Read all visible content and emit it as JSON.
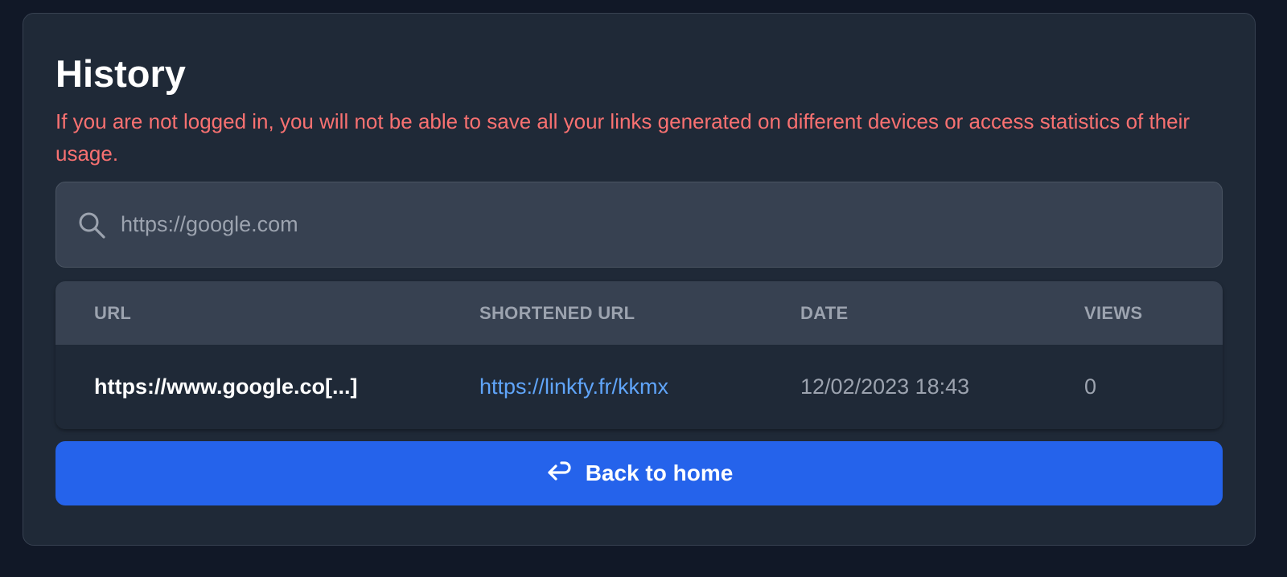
{
  "history": {
    "title": "History",
    "warning": "If you are not logged in, you will not be able to save all your links generated on different devices or access statistics of their usage."
  },
  "search": {
    "placeholder": "https://google.com",
    "value": "",
    "icon": "search-icon"
  },
  "table": {
    "headers": [
      "URL",
      "SHORTENED URL",
      "DATE",
      "VIEWS"
    ],
    "rows": [
      {
        "url": "https://www.google.co[...]",
        "shortened_url": "https://linkfy.fr/kkmx",
        "date": "12/02/2023 18:43",
        "views": "0"
      }
    ]
  },
  "back_button": {
    "label": "Back to home",
    "icon": "return-arrow-icon"
  },
  "colors": {
    "page_background": "#111827",
    "card_background": "#1f2937",
    "warning_text": "#f87171",
    "link": "#60a5fa",
    "primary_button": "#2563eb"
  }
}
